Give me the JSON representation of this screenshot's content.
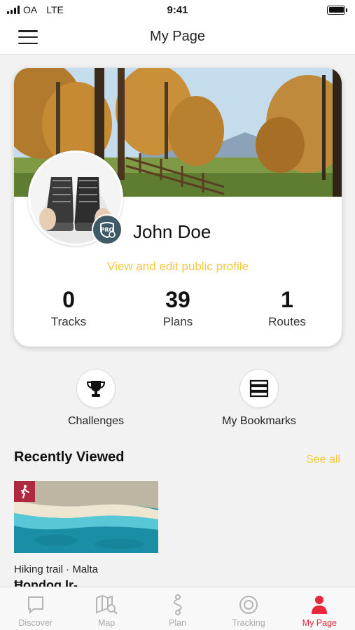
{
  "status_bar": {
    "carrier": "OA",
    "network": "LTE",
    "time": "9:41"
  },
  "header": {
    "title": "My Page"
  },
  "profile": {
    "name": "John Doe",
    "badge": "PRO",
    "edit_link": "View and edit public profile",
    "stats": [
      {
        "value": "0",
        "label": "Tracks"
      },
      {
        "value": "39",
        "label": "Plans"
      },
      {
        "value": "1",
        "label": "Routes"
      }
    ]
  },
  "shortcuts": [
    {
      "label": "Challenges",
      "icon": "trophy-icon"
    },
    {
      "label": "My Bookmarks",
      "icon": "bookmarks-icon"
    }
  ],
  "recently_viewed": {
    "title": "Recently Viewed",
    "see_all": "See all",
    "items": [
      {
        "meta": "Hiking trail · Malta",
        "name": "Ħondoq Ir-",
        "icon": "hiking-icon"
      }
    ]
  },
  "tab_bar": {
    "tabs": [
      {
        "label": "Discover",
        "icon": "discover-icon",
        "active": false
      },
      {
        "label": "Map",
        "icon": "map-icon",
        "active": false
      },
      {
        "label": "Plan",
        "icon": "plan-icon",
        "active": false
      },
      {
        "label": "Tracking",
        "icon": "tracking-icon",
        "active": false
      },
      {
        "label": "My Page",
        "icon": "user-icon",
        "active": true
      }
    ]
  },
  "colors": {
    "accent_yellow": "#f5c842",
    "active_red": "#e8283b",
    "badge_red": "#b0283e",
    "pro_badge": "#3e5a66"
  }
}
